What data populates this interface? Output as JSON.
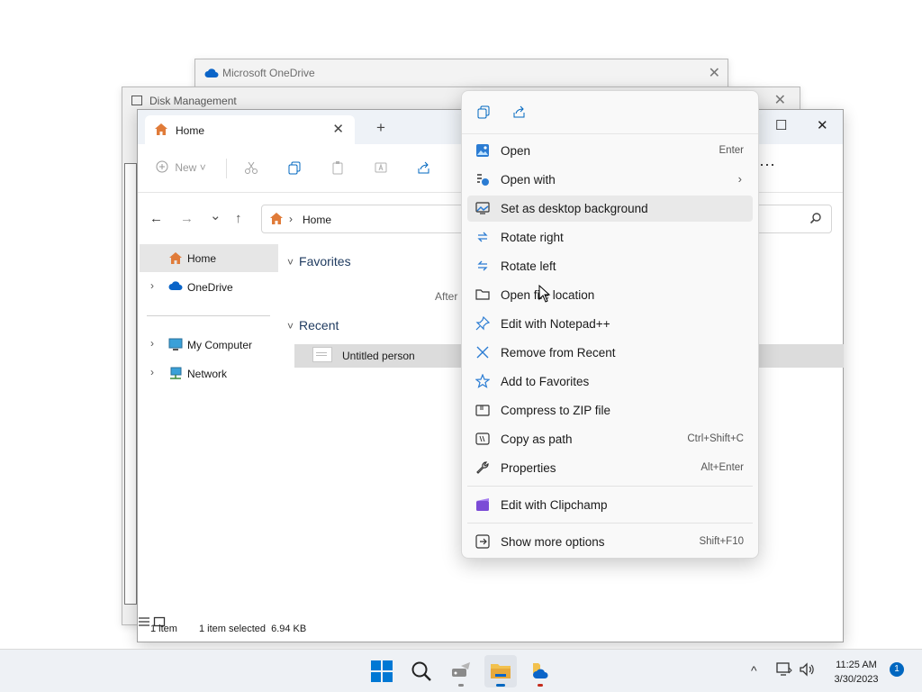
{
  "background_windows": {
    "onedrive_title": "Microsoft OneDrive",
    "disk_title": "Disk Management",
    "close_glyph": "✕"
  },
  "explorer": {
    "tab_label": "Home",
    "tab_close": "✕",
    "new_tab": "+",
    "maximize_glyph": "☐",
    "close_glyph": "✕",
    "toolbar": {
      "new_label": "New",
      "more": "···"
    },
    "address": {
      "crumb": "Home"
    },
    "nav": {
      "back": "←",
      "forward": "→",
      "recent": "⌄",
      "up": "↑"
    },
    "sidebar": [
      {
        "label": "Home",
        "icon": "home-icon",
        "selected": true
      },
      {
        "label": "OneDrive",
        "icon": "cloud-icon",
        "selected": false
      },
      {
        "label": "My Computer",
        "icon": "computer-icon",
        "selected": false
      },
      {
        "label": "Network",
        "icon": "network-icon",
        "selected": false
      }
    ],
    "content": {
      "favorites_heading": "Favorites",
      "favorites_hint": "After",
      "recent_heading": "Recent",
      "recent_items": [
        {
          "name": "Untitled person"
        }
      ]
    },
    "status": {
      "count": "1 item",
      "selection": "1 item selected  6.94 KB"
    }
  },
  "context_menu": {
    "top_icons": [
      "copy-icon",
      "share-icon"
    ],
    "items": [
      {
        "label": "Open",
        "shortcut": "Enter",
        "icon": "photo-icon"
      },
      {
        "label": "Open with",
        "shortcut": "",
        "icon": "open-with-icon",
        "submenu": "›"
      },
      {
        "label": "Set as desktop background",
        "shortcut": "",
        "icon": "desktop-icon",
        "highlighted": true
      },
      {
        "label": "Rotate right",
        "shortcut": "",
        "icon": "rotate-right-icon"
      },
      {
        "label": "Rotate left",
        "shortcut": "",
        "icon": "rotate-left-icon"
      },
      {
        "label": "Open file location",
        "shortcut": "",
        "icon": "folder-icon"
      },
      {
        "label": "Edit with Notepad++",
        "shortcut": "",
        "icon": "pin-icon"
      },
      {
        "label": "Remove from Recent",
        "shortcut": "",
        "icon": "remove-icon"
      },
      {
        "label": "Add to Favorites",
        "shortcut": "",
        "icon": "star-icon"
      },
      {
        "label": "Compress to ZIP file",
        "shortcut": "",
        "icon": "zip-icon"
      },
      {
        "label": "Copy as path",
        "shortcut": "Ctrl+Shift+C",
        "icon": "path-icon"
      },
      {
        "label": "Properties",
        "shortcut": "Alt+Enter",
        "icon": "wrench-icon"
      },
      {
        "label": "Edit with Clipchamp",
        "shortcut": "",
        "icon": "clipchamp-icon"
      },
      {
        "label": "Show more options",
        "shortcut": "Shift+F10",
        "icon": "more-options-icon"
      }
    ]
  },
  "taskbar": {
    "time": "11:25 AM",
    "date": "3/30/2023",
    "notification_count": "1",
    "tray_chevron": "^"
  },
  "colors": {
    "accent": "#0067c0",
    "folder": "#f2c14e",
    "home_icon": "#e07b39"
  }
}
